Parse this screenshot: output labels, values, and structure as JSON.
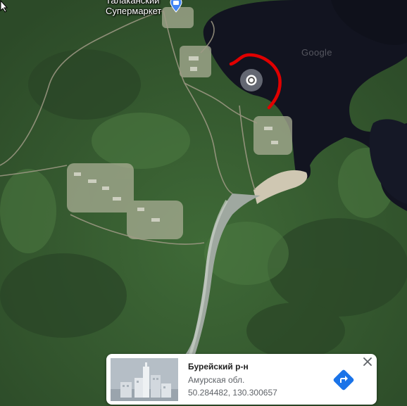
{
  "map": {
    "labels": {
      "line1": "Талаканский",
      "line2": "Супермаркет"
    },
    "watermark": "Google"
  },
  "info_card": {
    "title": "Бурейский р-н",
    "subtitle": "Амурская обл.",
    "coordinates": "50.284482, 130.300657"
  },
  "colors": {
    "accent": "#1a73e8",
    "annotation": "#e00000"
  }
}
